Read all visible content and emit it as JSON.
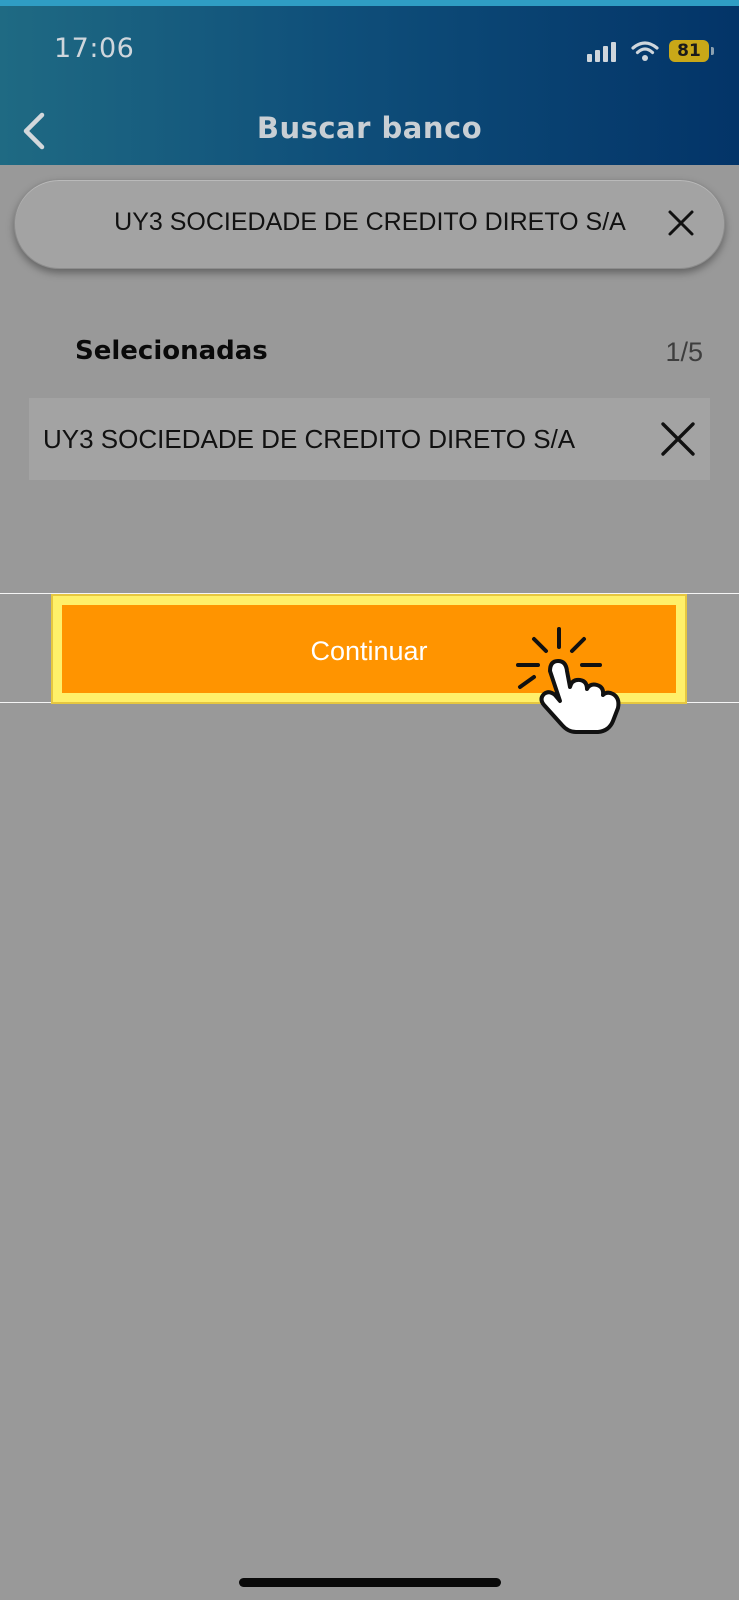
{
  "status_bar": {
    "time": "17:06",
    "battery": "81"
  },
  "header": {
    "title": "Buscar banco"
  },
  "search": {
    "value": "UY3 SOCIEDADE DE CREDITO DIRETO S/A"
  },
  "selected": {
    "label": "Selecionadas",
    "count": "1/5",
    "items": [
      {
        "label": "UY3 SOCIEDADE DE CREDITO DIRETO S/A"
      }
    ]
  },
  "actions": {
    "continue_label": "Continuar"
  },
  "colors": {
    "header_start": "#1f6a83",
    "header_end": "#033468",
    "button": "#ff9400",
    "highlight": "#fff06a",
    "overlay": "#999999"
  }
}
